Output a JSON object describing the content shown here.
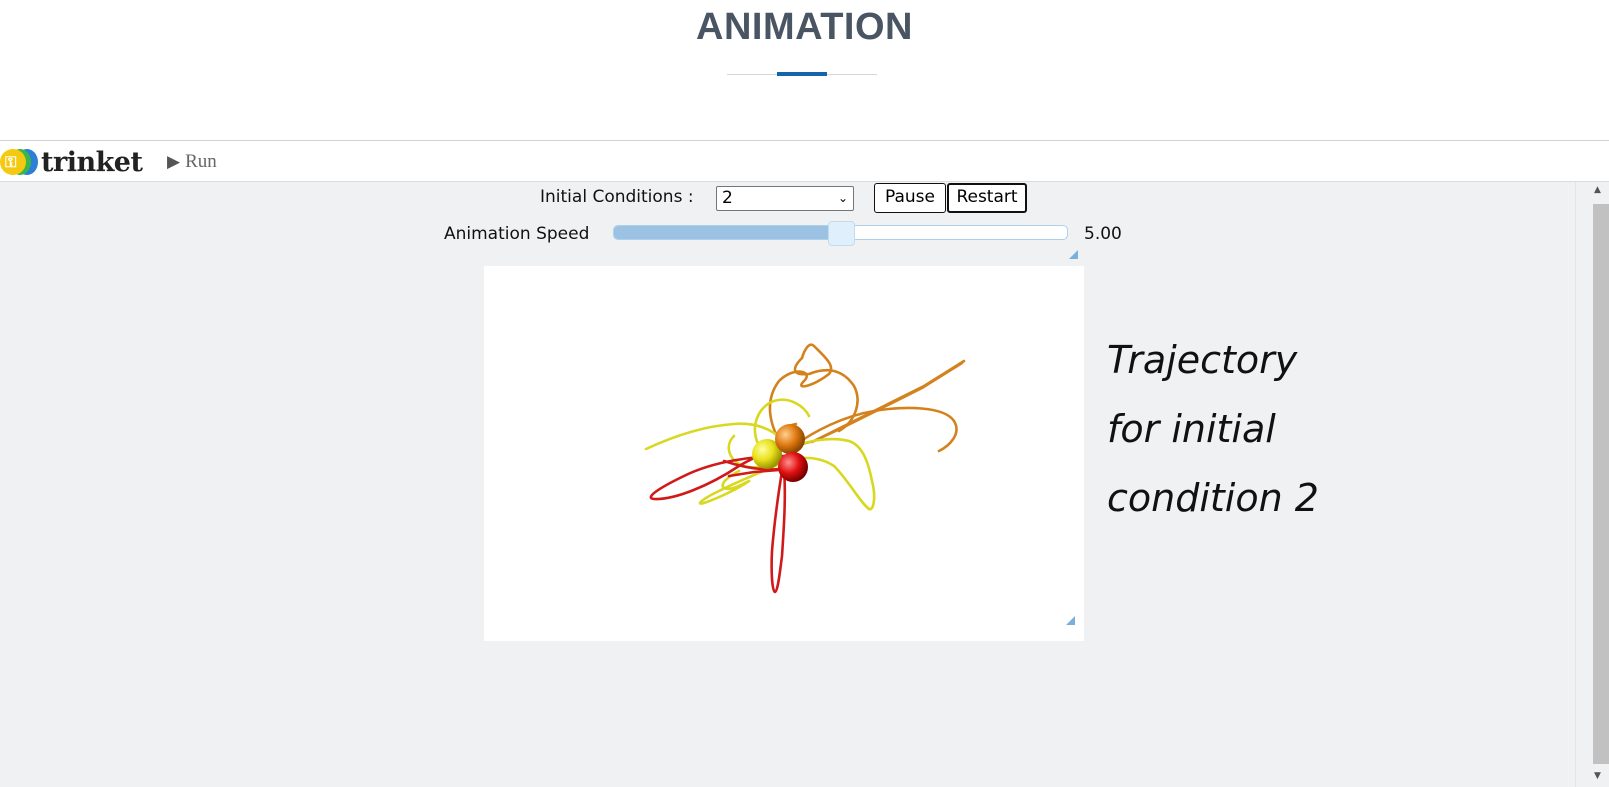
{
  "page": {
    "title": "ANIMATION"
  },
  "toolbar": {
    "logo_text": "trinket",
    "run_label": "Run"
  },
  "controls": {
    "initial_conditions_label": "Initial Conditions :",
    "initial_conditions_value": "2",
    "pause_label": "Pause",
    "restart_label": "Restart",
    "speed_label": "Animation Speed",
    "speed_value": "5.00",
    "speed_fraction": 0.5
  },
  "annotation": {
    "line1": "Trajectory",
    "line2": "for initial",
    "line3": "condition 2"
  },
  "icons": {
    "run": "play-icon",
    "select": "chevron-down-icon",
    "logo": "trinket-logo"
  },
  "colors": {
    "accent": "#1565a8",
    "body_yellow": "#e8e01a",
    "body_orange": "#e07a10",
    "body_red": "#e01010",
    "trail_yellow": "#d8d820",
    "trail_orange": "#d4821e",
    "trail_red": "#d01a1a"
  }
}
